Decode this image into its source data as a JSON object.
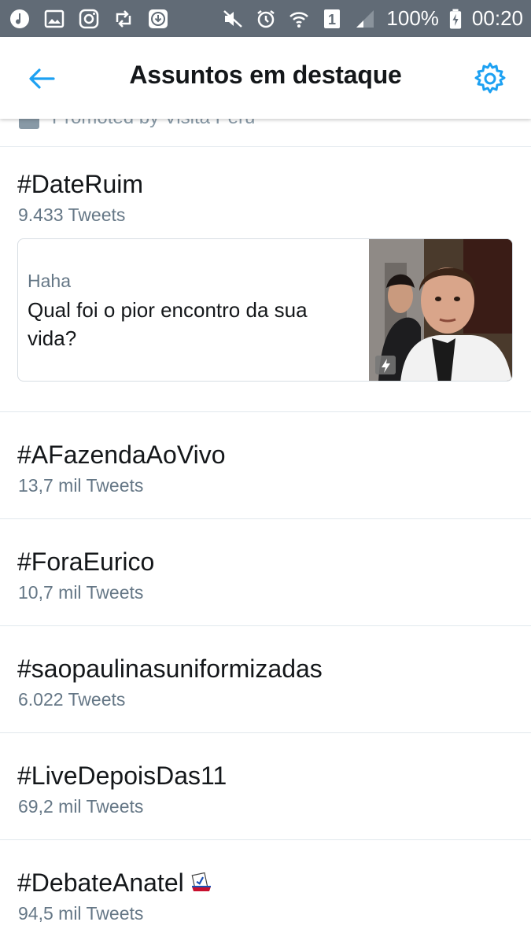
{
  "status_bar": {
    "battery": "100%",
    "time": "00:20",
    "sim": "1"
  },
  "header": {
    "title": "Assuntos em destaque"
  },
  "promoted": {
    "text": "Promoted by Visita Peru"
  },
  "featured": {
    "name": "#DateRuim",
    "count": "9.433 Tweets",
    "card_context": "Haha",
    "card_text": "Qual foi o pior encontro da sua vida?"
  },
  "trends": [
    {
      "name": "#AFazendaAoVivo",
      "count": "13,7 mil Tweets"
    },
    {
      "name": "#ForaEurico",
      "count": "10,7 mil Tweets"
    },
    {
      "name": "#saopaulinasuniformizadas",
      "count": "6.022 Tweets"
    },
    {
      "name": "#LiveDepoisDas11",
      "count": "69,2 mil Tweets"
    },
    {
      "name": "#DebateAnatel",
      "count": "94,5 mil Tweets"
    }
  ],
  "colors": {
    "accent": "#1da1f2",
    "status_bar": "#616b76",
    "secondary_text": "#657786"
  }
}
